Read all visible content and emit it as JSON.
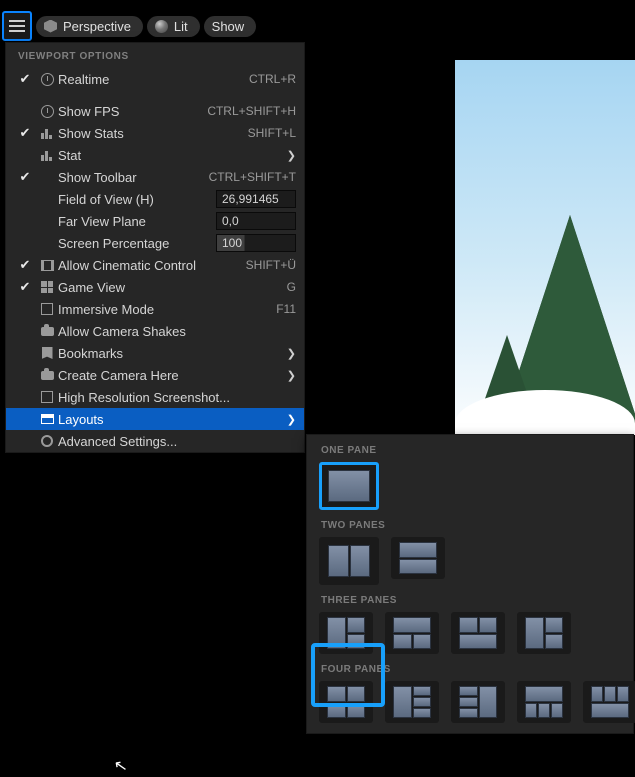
{
  "toolbar": {
    "perspective": "Perspective",
    "lit": "Lit",
    "show": "Show"
  },
  "menu": {
    "header": "VIEWPORT OPTIONS",
    "items": {
      "realtime": {
        "label": "Realtime",
        "shortcut": "CTRL+R",
        "checked": true
      },
      "show_fps": {
        "label": "Show FPS",
        "shortcut": "CTRL+SHIFT+H",
        "checked": false
      },
      "show_stats": {
        "label": "Show Stats",
        "shortcut": "SHIFT+L",
        "checked": true
      },
      "stat": {
        "label": "Stat",
        "checked": false,
        "arrow": true
      },
      "show_toolbar": {
        "label": "Show Toolbar",
        "shortcut": "CTRL+SHIFT+T",
        "checked": true
      },
      "fov": {
        "label": "Field of View (H)",
        "value": "26,991465"
      },
      "far_plane": {
        "label": "Far View Plane",
        "value": "0,0"
      },
      "screen_pct": {
        "label": "Screen Percentage",
        "value": "100"
      },
      "cinematic": {
        "label": "Allow Cinematic Control",
        "shortcut": "SHIFT+Ü",
        "checked": true
      },
      "game_view": {
        "label": "Game View",
        "shortcut": "G",
        "checked": true
      },
      "immersive": {
        "label": "Immersive Mode",
        "shortcut": "F11",
        "checked": false
      },
      "camera_shakes": {
        "label": "Allow Camera Shakes",
        "checked": false
      },
      "bookmarks": {
        "label": "Bookmarks",
        "arrow": true
      },
      "create_cam": {
        "label": "Create Camera Here",
        "arrow": true
      },
      "hires": {
        "label": "High Resolution Screenshot..."
      },
      "layouts": {
        "label": "Layouts",
        "arrow": true,
        "highlight": true
      },
      "advanced": {
        "label": "Advanced Settings..."
      }
    }
  },
  "layouts_submenu": {
    "one": "ONE PANE",
    "two": "TWO PANES",
    "three": "THREE PANES",
    "four": "FOUR PANES"
  }
}
